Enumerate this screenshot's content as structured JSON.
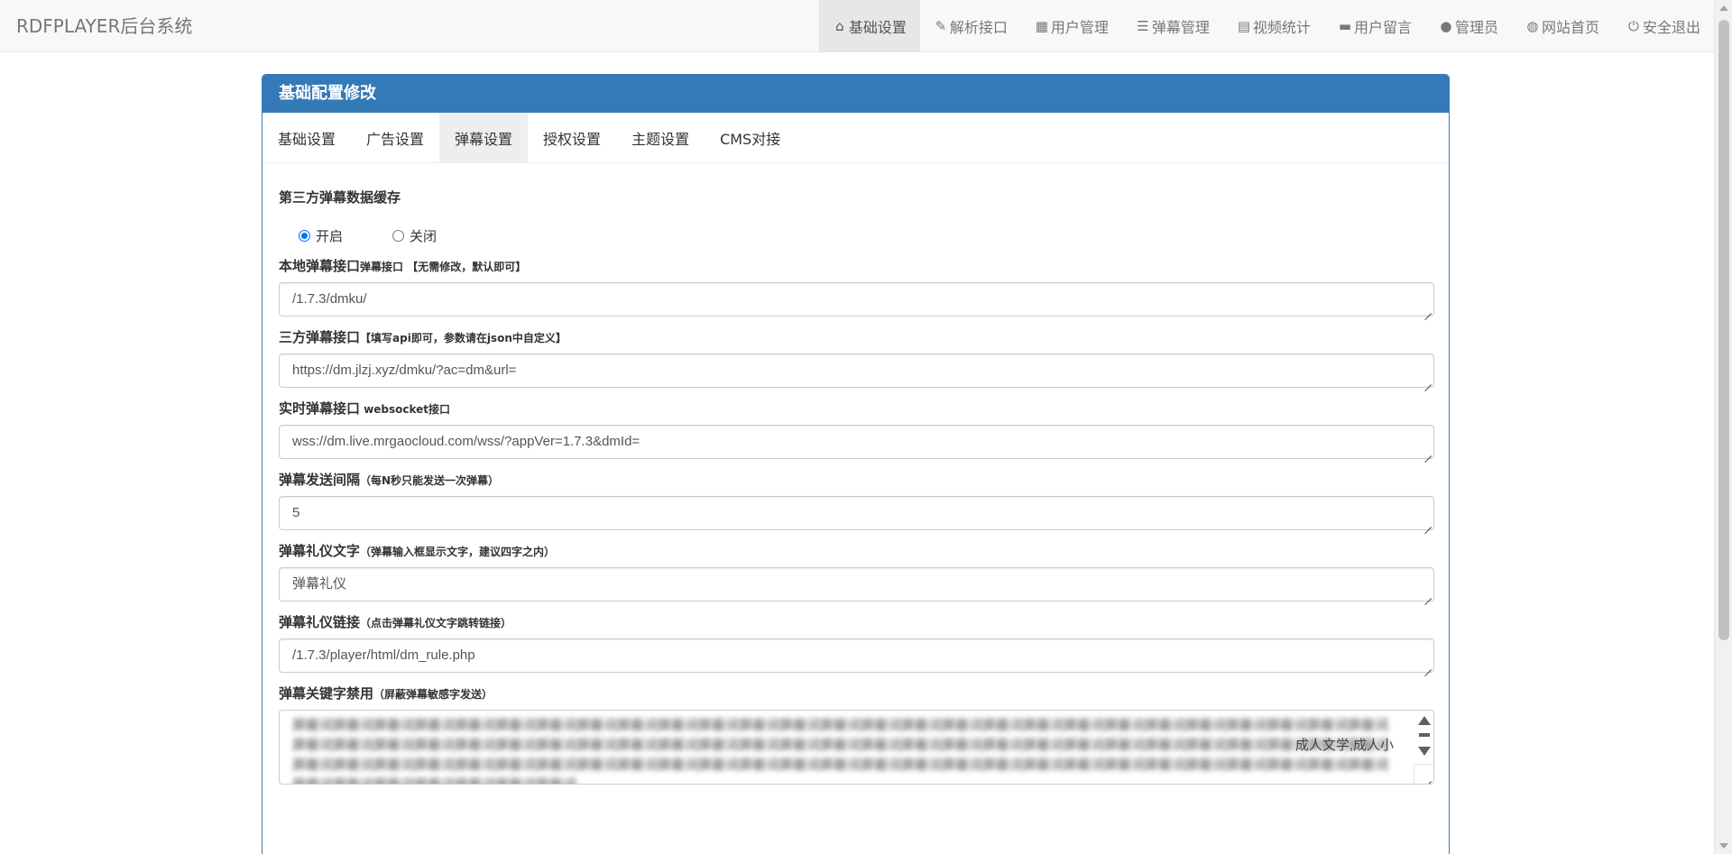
{
  "brand": "RDFPLAYER后台系统",
  "nav": [
    {
      "label": "基础设置",
      "icon": "home-icon",
      "glyph": "⌂",
      "active": true
    },
    {
      "label": "解析接口",
      "icon": "edit-icon",
      "glyph": "✎",
      "active": false
    },
    {
      "label": "用户管理",
      "icon": "grid-icon",
      "glyph": "▦",
      "active": false
    },
    {
      "label": "弹幕管理",
      "icon": "list-icon",
      "glyph": "☰",
      "active": false
    },
    {
      "label": "视频统计",
      "icon": "film-icon",
      "glyph": "▤",
      "active": false
    },
    {
      "label": "用户留言",
      "icon": "comment-icon",
      "glyph": "▬",
      "active": false
    },
    {
      "label": "管理员",
      "icon": "user-icon",
      "glyph": "●",
      "active": false
    },
    {
      "label": "网站首页",
      "icon": "globe-icon",
      "glyph": "◍",
      "active": false
    },
    {
      "label": "安全退出",
      "icon": "power-icon",
      "glyph": "⏻",
      "active": false
    }
  ],
  "panel": {
    "title": "基础配置修改",
    "tabs": [
      "基础设置",
      "广告设置",
      "弹幕设置",
      "授权设置",
      "主题设置",
      "CMS对接"
    ],
    "active_tab": 2
  },
  "cache": {
    "title": "第三方弹幕数据缓存",
    "on_label": "开启",
    "off_label": "关闭",
    "selected": "开启"
  },
  "fields": [
    {
      "label": "本地弹幕接口",
      "hint": "弹幕接口 【无需修改，默认即可】",
      "value": "/1.7.3/dmku/"
    },
    {
      "label": "三方弹幕接口",
      "hint": "【填写api即可，参数请在json中自定义】",
      "value": "https://dm.jlzj.xyz/dmku/?ac=dm&url="
    },
    {
      "label": "实时弹幕接口",
      "hint": " websocket接口",
      "value": "wss://dm.live.mrgaocloud.com/wss/?appVer=1.7.3&dmId="
    },
    {
      "label": "弹幕发送间隔",
      "hint": "（每N秒只能发送一次弹幕）",
      "value": "5"
    },
    {
      "label": "弹幕礼仪文字",
      "hint": "（弹幕输入框显示文字，建议四字之内）",
      "value": "弹幕礼仪"
    },
    {
      "label": "弹幕礼仪链接",
      "hint": "（点击弹幕礼仪文字跳转链接）",
      "value": "/1.7.3/player/html/dm_rule.php"
    }
  ],
  "keywords": {
    "label": "弹幕关键字禁用",
    "hint": "（屏蔽弹幕敏感字发送）",
    "value": "成人文学,成人小"
  }
}
